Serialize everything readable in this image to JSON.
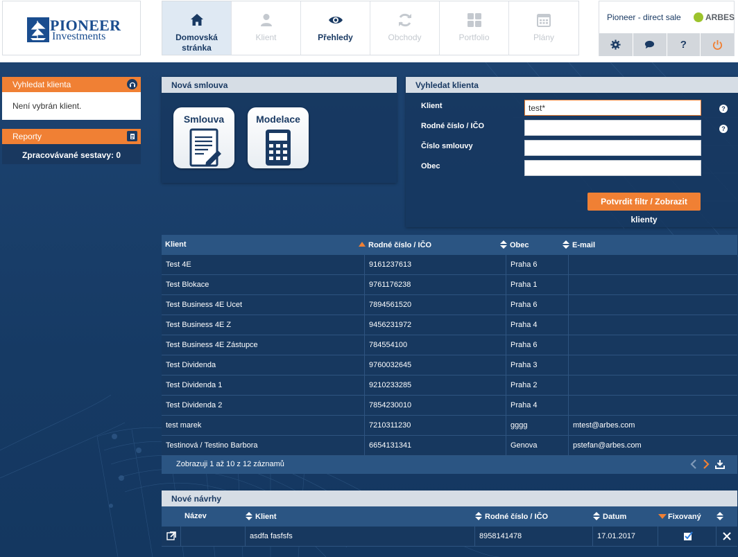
{
  "header": {
    "logo": {
      "line1": "PIONEER",
      "line2": "Investments"
    },
    "nav": [
      {
        "label": "Domovská stránka",
        "icon": "home-icon",
        "state": "active"
      },
      {
        "label": "Klient",
        "icon": "user-icon",
        "state": "disabled"
      },
      {
        "label": "Přehledy",
        "icon": "eye-icon",
        "state": "enabled"
      },
      {
        "label": "Obchody",
        "icon": "refresh-icon",
        "state": "disabled"
      },
      {
        "label": "Portfolio",
        "icon": "grid-icon",
        "state": "disabled"
      },
      {
        "label": "Plány",
        "icon": "calendar-icon",
        "state": "disabled"
      }
    ],
    "user": {
      "name": "Pioneer - direct sale",
      "brand": "ARBES"
    },
    "actions": [
      {
        "icon": "gear-icon"
      },
      {
        "icon": "chat-icon"
      },
      {
        "icon": "help-icon",
        "label": "?"
      },
      {
        "icon": "power-icon"
      }
    ]
  },
  "sidebar": {
    "search": {
      "title": "Vyhledat klienta",
      "body": "Není vybrán klient."
    },
    "reports": {
      "title": "Reporty",
      "body": "Zpracovávané sestavy: 0"
    }
  },
  "new_contract": {
    "title": "Nová smlouva",
    "tiles": [
      {
        "label": "Smlouva",
        "icon": "contract-icon"
      },
      {
        "label": "Modelace",
        "icon": "calculator-icon"
      }
    ]
  },
  "search": {
    "title": "Vyhledat klienta",
    "fields": [
      {
        "label": "Klient",
        "value": "test*",
        "help": true
      },
      {
        "label": "Rodné číslo / IČO",
        "value": "",
        "help": true
      },
      {
        "label": "Číslo smlouvy",
        "value": "",
        "help": false
      },
      {
        "label": "Obec",
        "value": "",
        "help": false
      }
    ],
    "submit": "Potvrdit filtr / Zobrazit klienty"
  },
  "clients": {
    "columns": [
      "Klient",
      "Rodné číslo / IČO",
      "Obec",
      "E-mail"
    ],
    "rows": [
      [
        "Test 4E",
        "9161237613",
        "Praha 6",
        ""
      ],
      [
        "Test Blokace",
        "9761176238",
        "Praha 1",
        ""
      ],
      [
        "Test Business 4E Ucet",
        "7894561520",
        "Praha 6",
        ""
      ],
      [
        "Test Business 4E Z",
        "9456231972",
        "Praha 4",
        ""
      ],
      [
        "Test Business 4E Zástupce",
        "784554100",
        "Praha 6",
        ""
      ],
      [
        "Test Dividenda",
        "9760032645",
        "Praha 3",
        ""
      ],
      [
        "Test Dividenda 1",
        "9210233285",
        "Praha 2",
        ""
      ],
      [
        "Test Dividenda 2",
        "7854230010",
        "Praha 4",
        ""
      ],
      [
        "test marek",
        "7210311230",
        "gggg",
        "mtest@arbes.com"
      ],
      [
        "Testinová / Testino Barbora",
        "6654131341",
        "Genova",
        "pstefan@arbes.com"
      ]
    ],
    "footer": "Zobrazuji 1 až 10 z 12 záznamů"
  },
  "proposals": {
    "title": "Nové návrhy",
    "columns": [
      "Název",
      "Klient",
      "Rodné číslo / IČO",
      "Datum",
      "Fixovaný"
    ],
    "rows": [
      {
        "name": "",
        "client": "asdfa fasfsfs",
        "id": "8958141478",
        "date": "17.01.2017",
        "fixed": true
      }
    ]
  },
  "colors": {
    "accent": "#f08034",
    "navy": "#1a3a63",
    "row": "#17385f"
  }
}
